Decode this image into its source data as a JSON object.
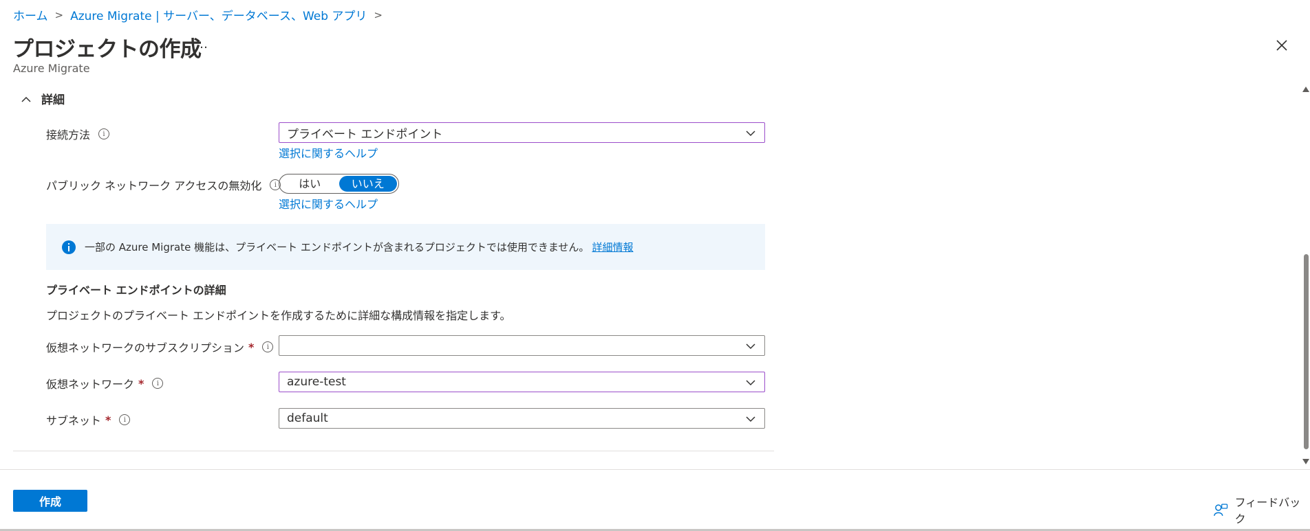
{
  "breadcrumb": {
    "home": "ホーム",
    "parent": "Azure Migrate | サーバー、データベース、Web アプリ"
  },
  "header": {
    "title": "プロジェクトの作成",
    "more": "…",
    "subtitle": "Azure Migrate"
  },
  "section": {
    "title": "詳細"
  },
  "connection": {
    "label": "接続方法",
    "value": "プライベート エンドポイント",
    "help": "選択に関するヘルプ"
  },
  "public_access": {
    "label": "パブリック ネットワーク アクセスの無効化",
    "options": [
      "はい",
      "いいえ"
    ],
    "selected": "いいえ",
    "help": "選択に関するヘルプ"
  },
  "infobar": {
    "text": "一部の Azure Migrate 機能は、プライベート エンドポイントが含まれるプロジェクトでは使用できません。",
    "link": "詳細情報"
  },
  "private_endpoint": {
    "title": "プライベート エンドポイントの詳細",
    "description": "プロジェクトのプライベート エンドポイントを作成するために詳細な構成情報を指定します。",
    "subscription": {
      "label": "仮想ネットワークのサブスクリプション",
      "value": ""
    },
    "vnet": {
      "label": "仮想ネットワーク",
      "value": "azure-test"
    },
    "subnet": {
      "label": "サブネット",
      "value": "default"
    },
    "required_mark": "*"
  },
  "footer": {
    "create": "作成",
    "feedback": "フィードバック"
  },
  "colors": {
    "accent": "#0078d4",
    "focus_border": "#9b4dca",
    "info_bg": "#eff6fc",
    "required": "#a4262c"
  }
}
